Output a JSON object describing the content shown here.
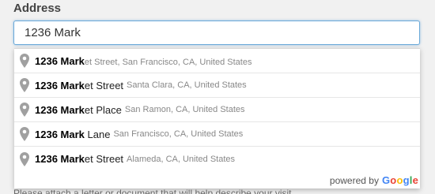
{
  "field": {
    "label": "Address",
    "value": "1236 Mark"
  },
  "suggestions": [
    {
      "matched": "1236 ",
      "matched_b": "Mark",
      "rest": "et Street, San Francisco, CA, United States",
      "secondary": ""
    },
    {
      "matched": "1236 ",
      "matched_b": "Mark",
      "rest": "et Street",
      "secondary": "Santa Clara, CA, United States"
    },
    {
      "matched": "1236 ",
      "matched_b": "Mark",
      "rest": "et Place",
      "secondary": "San Ramon, CA, United States"
    },
    {
      "matched": "1236 ",
      "matched_b": "Mark",
      "rest": " Lane",
      "secondary": "San Francisco, CA, United States"
    },
    {
      "matched": "1236 ",
      "matched_b": "Mark",
      "rest": "et Street",
      "secondary": "Alameda, CA, United States"
    }
  ],
  "footer": {
    "powered_by": "powered by",
    "brand": "Google"
  },
  "colors": {
    "accent": "#6aa9d9",
    "pin": "#a0a0a0",
    "google_blue": "#4285f4",
    "google_red": "#ea4335",
    "google_yellow": "#fbbc05",
    "google_green": "#34a853"
  },
  "icons": {
    "pin": "map-pin-icon"
  },
  "hint": "Please attach a letter or document that will help describe your visit"
}
